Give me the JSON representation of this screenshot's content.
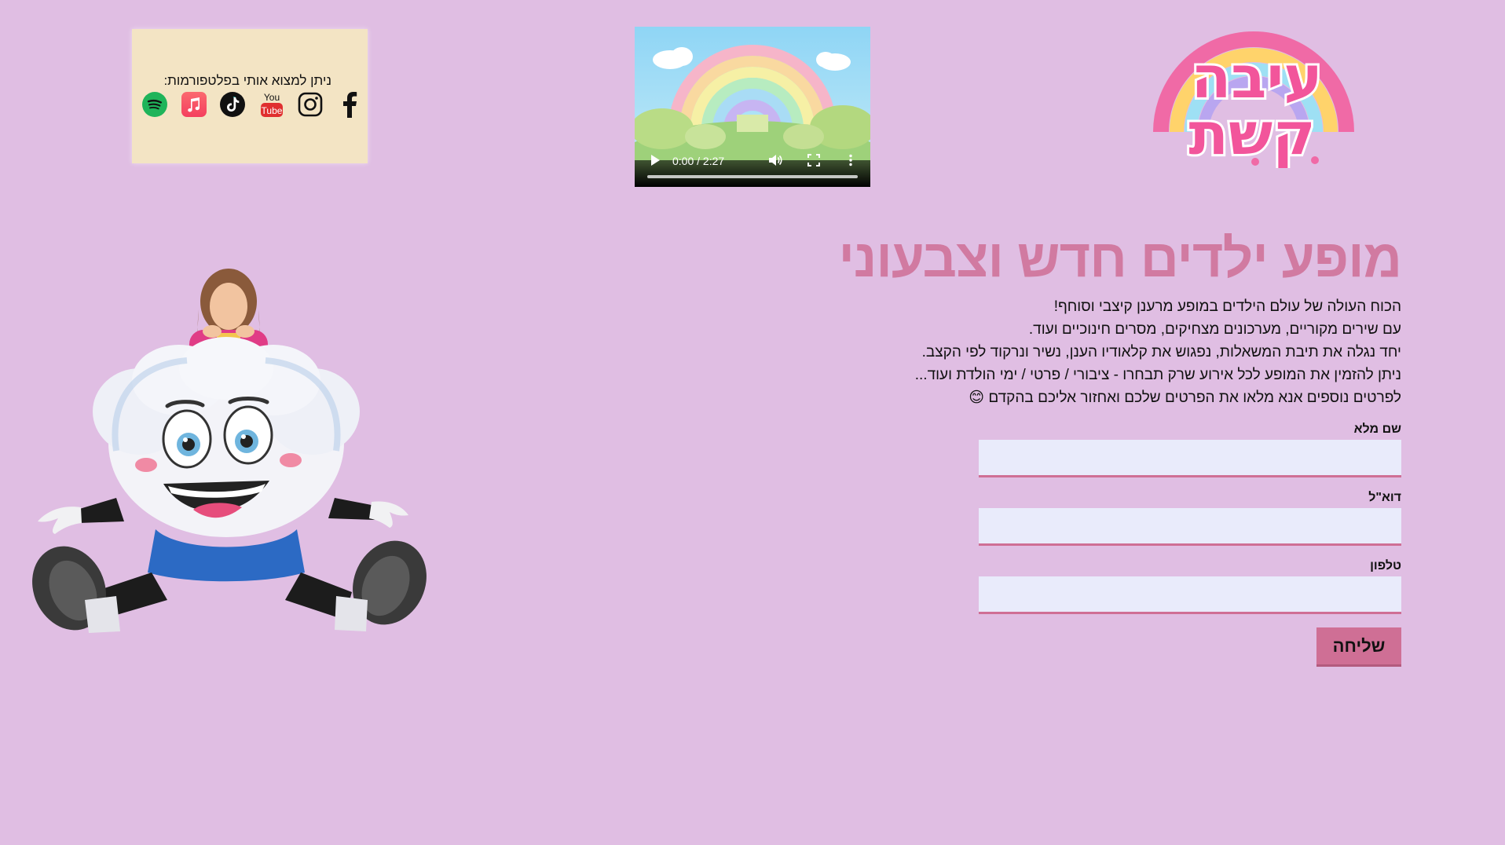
{
  "social": {
    "title": "ניתן למצוא אותי בפלטפורמות:",
    "icons": [
      "facebook-icon",
      "instagram-icon",
      "youtube-icon",
      "tiktok-icon",
      "apple-music-icon",
      "spotify-icon"
    ],
    "youtube_text": "You",
    "youtube_tube": "Tube"
  },
  "video": {
    "time": "0:00 / 2:27"
  },
  "logo": {
    "line1": "עיבה",
    "line2": "קשת",
    "colors": [
      "#f06aa6",
      "#ffd36b",
      "#9ee0f4",
      "#b9a6f0"
    ]
  },
  "main": {
    "headline": "מופע ילדים חדש וצבעוני",
    "description": [
      "הכוח העולה של עולם הילדים במופע מרענן קיצבי וסוחף!",
      "עם שירים מקוריים, מערכונים מצחיקים, מסרים חינוכיים ועוד.",
      "יחד נגלה את תיבת המשאלות, נפגוש את קלאודיו הענן, נשיר ונרקוד לפי הקצב.",
      "ניתן להזמין את המופע לכל אירוע שרק תבחרו - ציבורי / פרטי / ימי הולדת ועוד...",
      "לפרטים נוספים אנא מלאו את הפרטים שלכם ואחזור אליכם בהקדם 😊"
    ]
  },
  "form": {
    "name_label": "שם מלא",
    "email_label": "דוא\"ל",
    "phone_label": "טלפון",
    "submit_label": "שליחה"
  },
  "colors": {
    "background": "#e0bee3",
    "accent": "#cf6f95",
    "headline": "#d17aa1",
    "social_box": "#f3e4c4",
    "input_bg": "#e9ebfb"
  }
}
